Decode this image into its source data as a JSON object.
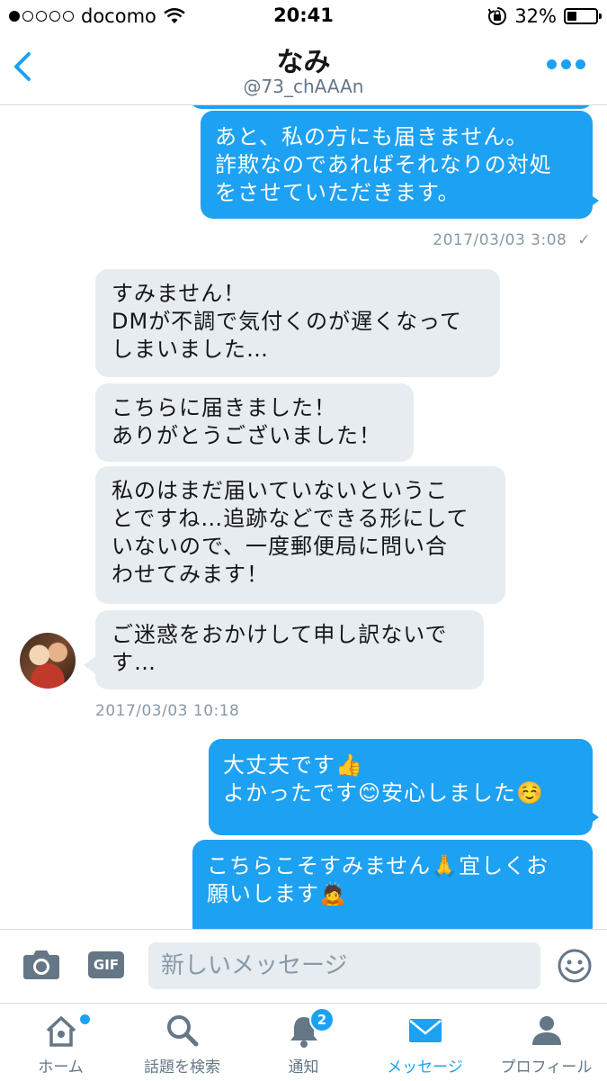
{
  "status_bar": {
    "carrier": "docomo",
    "time": "20:41",
    "battery": "32%",
    "battery_level": 0.32
  },
  "header": {
    "name": "なみ",
    "handle": "@73_chAAAn"
  },
  "messages": [
    {
      "side": "sent",
      "text": "あと、私の方にも届きません。\n詐欺なのであればそれなりの対処\nをさせていただきます。"
    },
    {
      "side": "received",
      "text": "すみません！\nDMが不調で気付くのが遅くなって\nしまいました…"
    },
    {
      "side": "received",
      "text": "こちらに届きました！\nありがとうございました！"
    },
    {
      "side": "received",
      "text": "私のはまだ届いていないというこ\nとですね…追跡などできる形にして\nいないので、一度郵便局に問い合\nわせてみます！"
    },
    {
      "side": "received",
      "text": "ご迷惑をおかけして申し訳ないで\nす…"
    },
    {
      "side": "sent",
      "text": "大丈夫です👍\nよかったです😊安心しました☺️"
    },
    {
      "side": "sent",
      "text": "こちらこそすみません🙏宜しくお\n願いします🙇"
    }
  ],
  "timestamps": {
    "first": "2017/03/03 3:08",
    "second": "2017/03/03 10:18",
    "read_mark": "✓"
  },
  "composer": {
    "placeholder": "新しいメッセージ",
    "gif_label": "GIF"
  },
  "tabs": [
    {
      "label": "ホーム",
      "icon": "home-icon"
    },
    {
      "label": "話題を検索",
      "icon": "search-icon"
    },
    {
      "label": "通知",
      "icon": "bell-icon",
      "badge": "2"
    },
    {
      "label": "メッセージ",
      "icon": "mail-icon"
    },
    {
      "label": "プロフィール",
      "icon": "person-icon"
    }
  ],
  "colors": {
    "accent": "#1da1f2",
    "received_bubble": "#e6ecf0",
    "muted_text": "#8899a6"
  }
}
